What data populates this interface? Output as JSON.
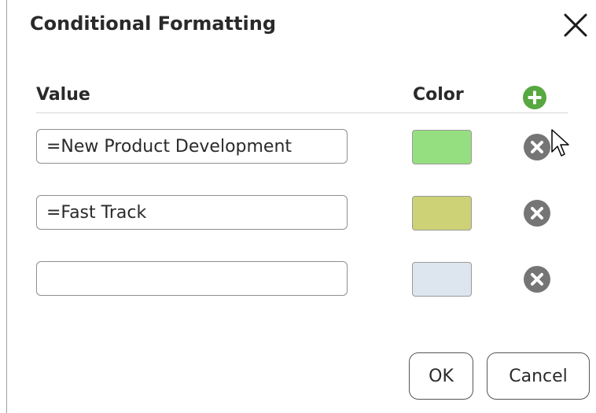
{
  "dialog": {
    "title": "Conditional Formatting",
    "close_icon": "close-icon"
  },
  "table": {
    "value_header": "Value",
    "color_header": "Color",
    "add_icon": "plus-circle-icon",
    "rows": [
      {
        "value": "=New Product Development",
        "color": "#96df80",
        "remove_icon": "x-circle-icon"
      },
      {
        "value": "=Fast Track",
        "color": "#cdd277",
        "remove_icon": "x-circle-icon"
      },
      {
        "value": "",
        "color": "#dde6ee",
        "remove_icon": "x-circle-icon"
      }
    ]
  },
  "buttons": {
    "ok": "OK",
    "cancel": "Cancel"
  },
  "colors": {
    "add_green": "#57a840",
    "remove_gray": "#757575"
  }
}
